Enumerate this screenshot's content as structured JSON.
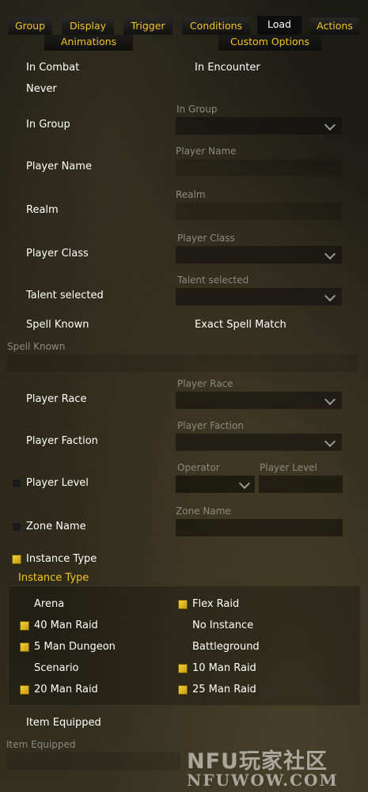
{
  "tabs": {
    "group": "Group",
    "display": "Display",
    "trigger": "Trigger",
    "conditions": "Conditions",
    "load": "Load",
    "actions": "Actions",
    "animations": "Animations",
    "custom_options": "Custom Options"
  },
  "options": {
    "in_combat": "In Combat",
    "in_encounter": "In Encounter",
    "never": "Never",
    "in_group": "In Group",
    "in_group_dropdown_label": "In Group",
    "player_name": "Player Name",
    "player_name_field_label": "Player Name",
    "realm_field_label": "Realm",
    "realm": "Realm",
    "player_class_dropdown_label": "Player Class",
    "player_class": "Player Class",
    "talent_selected_dropdown_label": "Talent selected",
    "talent_selected": "Talent selected",
    "spell_known": "Spell Known",
    "exact_spell_match": "Exact Spell Match",
    "spell_known_input_label": "Spell Known",
    "player_race_dropdown_label": "Player Race",
    "player_race": "Player Race",
    "player_faction_dropdown_label": "Player Faction",
    "player_faction": "Player Faction",
    "operator_label": "Operator",
    "player_level_field_label": "Player Level",
    "player_level": "Player Level",
    "zone_name_field_label": "Zone Name",
    "zone_name": "Zone Name",
    "instance_type": "Instance Type",
    "item_equipped": "Item Equipped",
    "item_equipped_input_label": "Item Equipped"
  },
  "instance_types": {
    "header": "Instance Type",
    "arena": "Arena",
    "flex_raid": "Flex Raid",
    "raid_40": "40 Man Raid",
    "no_instance": "No Instance",
    "dungeon_5": "5 Man Dungeon",
    "battleground": "Battleground",
    "scenario": "Scenario",
    "raid_10": "10 Man Raid",
    "raid_20": "20 Man Raid",
    "raid_25": "25 Man Raid"
  },
  "watermark": {
    "logo_text": "NFU玩家社区",
    "url_text": "NFUWOW.COM"
  },
  "colors": {
    "accent_gold": "#f5c518",
    "label_white": "#ffffff",
    "dim_label": "#8a8a80"
  }
}
